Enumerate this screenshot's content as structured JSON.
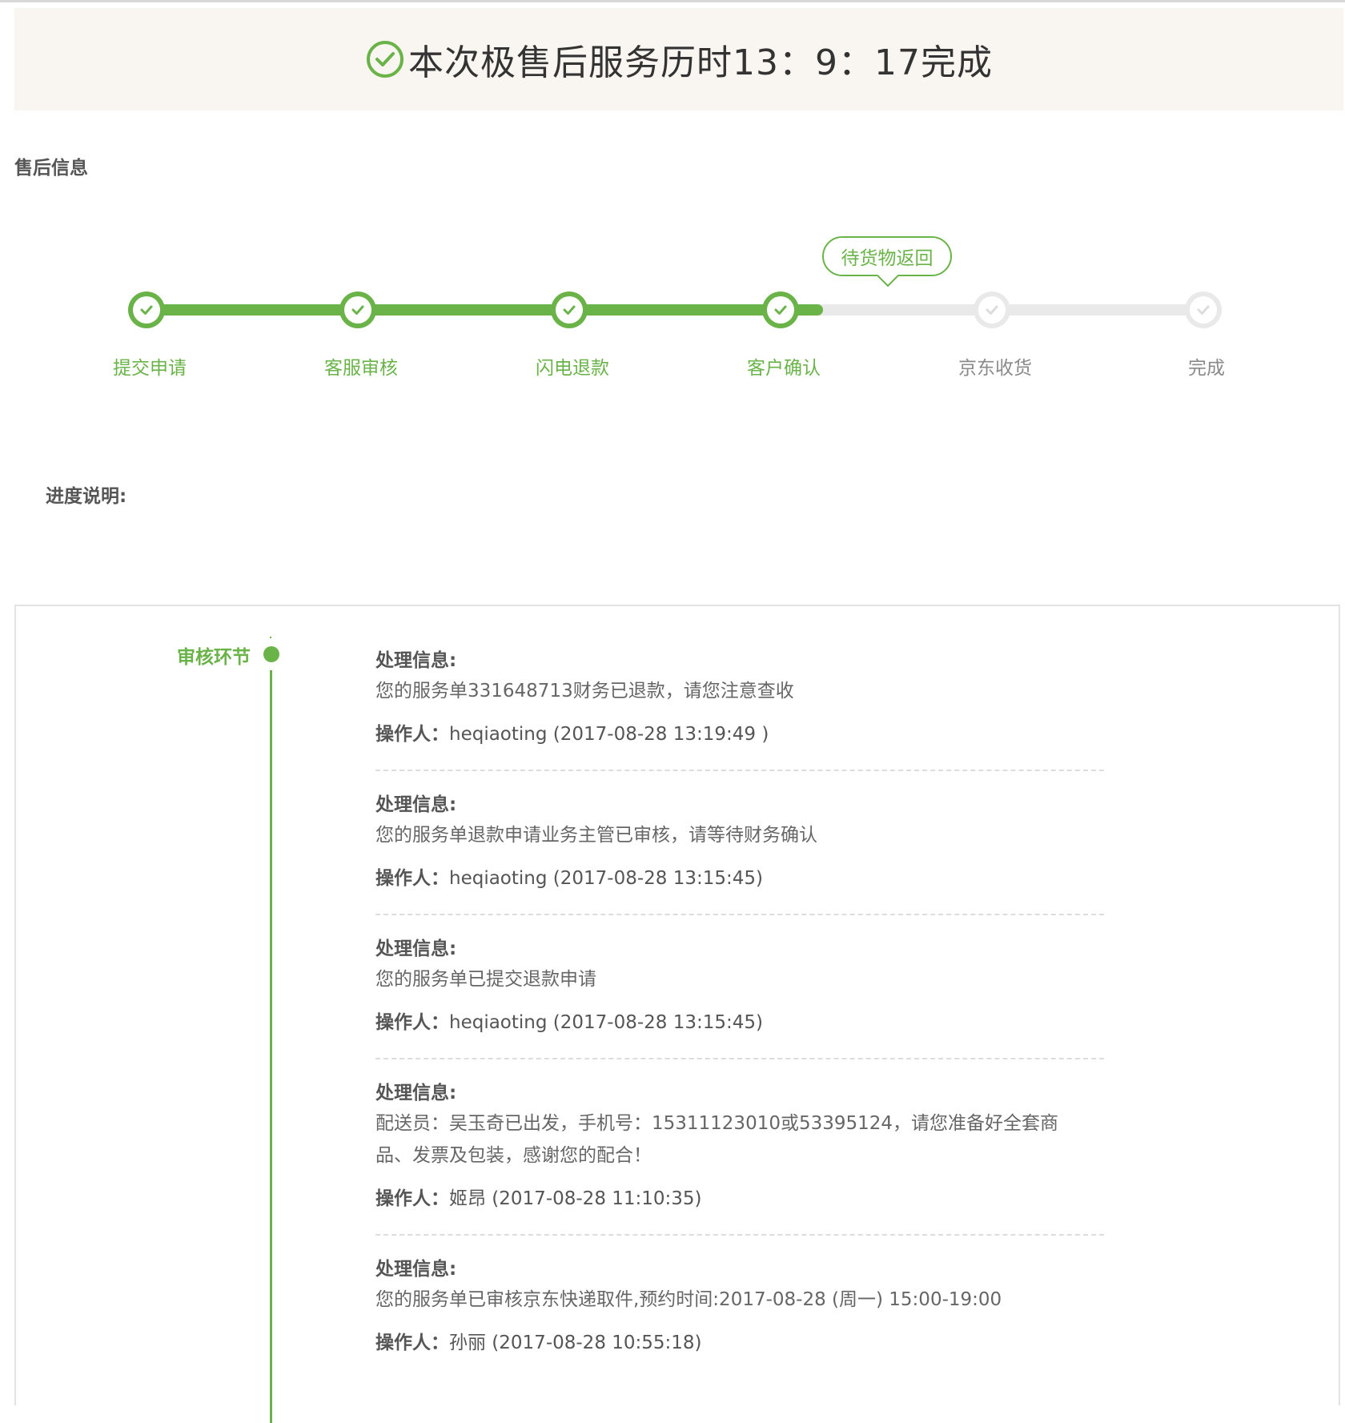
{
  "banner": {
    "title": "本次极售后服务历时13：9：17完成",
    "icon": "check-circle-icon",
    "accent": "#6ab349"
  },
  "section_title": "售后信息",
  "progress": {
    "fill_fraction": 0.64,
    "bubble_text": "待货物返回",
    "steps": [
      {
        "label": "提交申请",
        "done": true
      },
      {
        "label": "客服审核",
        "done": true
      },
      {
        "label": "闪电退款",
        "done": true
      },
      {
        "label": "客户确认",
        "done": true
      },
      {
        "label": "京东收货",
        "done": false
      },
      {
        "label": "完成",
        "done": false
      }
    ]
  },
  "desc_label": "进度说明:",
  "log": {
    "stage_label": "审核环节",
    "entries": [
      {
        "head": "处理信息:",
        "message": "您的服务单331648713财务已退款，请您注意查收",
        "operator_key": "操作人：",
        "operator_val": "heqiaoting (2017-08-28 13:19:49 )"
      },
      {
        "head": "处理信息:",
        "message": "您的服务单退款申请业务主管已审核，请等待财务确认",
        "operator_key": "操作人：",
        "operator_val": "heqiaoting (2017-08-28 13:15:45)"
      },
      {
        "head": "处理信息:",
        "message": "您的服务单已提交退款申请",
        "operator_key": "操作人：",
        "operator_val": "heqiaoting (2017-08-28 13:15:45)"
      },
      {
        "head": "处理信息:",
        "message": "配送员：吴玉奇已出发，手机号：15311123010或53395124，请您准备好全套商品、发票及包装，感谢您的配合！",
        "operator_key": "操作人：",
        "operator_val": "姬昂 (2017-08-28 11:10:35)"
      },
      {
        "head": "处理信息:",
        "message": "您的服务单已审核京东快递取件,预约时间:2017-08-28 (周一) 15:00-19:00",
        "operator_key": "操作人：",
        "operator_val": "孙丽 (2017-08-28 10:55:18)"
      }
    ]
  }
}
